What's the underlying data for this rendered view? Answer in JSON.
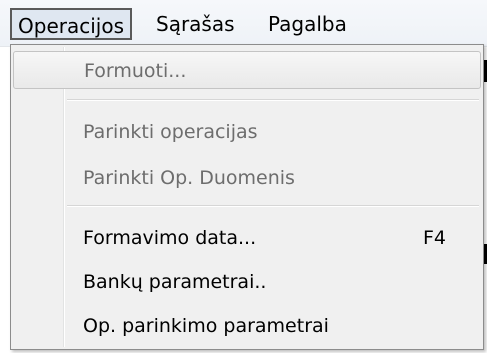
{
  "menubar": {
    "items": [
      {
        "label": "Operacijos",
        "active": true
      },
      {
        "label": "Sąrašas",
        "active": false
      },
      {
        "label": "Pagalba",
        "active": false
      }
    ]
  },
  "menu": {
    "items": [
      {
        "label": "Formuoti...",
        "shortcut": "",
        "enabled": false,
        "highlighted": true
      },
      {
        "label": "Parinkti operacijas",
        "shortcut": "",
        "enabled": false
      },
      {
        "label": "Parinkti Op. Duomenis",
        "shortcut": "",
        "enabled": false
      },
      {
        "label": "Formavimo data...",
        "shortcut": "F4",
        "enabled": true
      },
      {
        "label": "Bankų parametrai..",
        "shortcut": "",
        "enabled": true
      },
      {
        "label": "Op. parinkimo parametrai",
        "shortcut": "",
        "enabled": true
      }
    ]
  }
}
